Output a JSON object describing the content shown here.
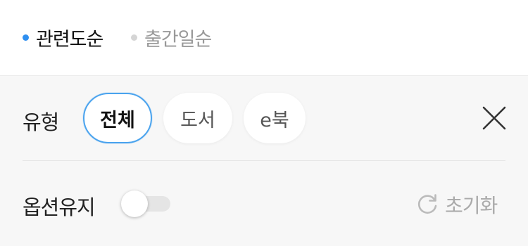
{
  "sort": {
    "options": [
      {
        "label": "관련도순",
        "active": true
      },
      {
        "label": "출간일순",
        "active": false
      }
    ]
  },
  "filter": {
    "type_label": "유형",
    "chips": [
      {
        "label": "전체",
        "selected": true
      },
      {
        "label": "도서",
        "selected": false
      },
      {
        "label": "e북",
        "selected": false
      }
    ],
    "close_icon": "close-icon",
    "keep_option_label": "옵션유지",
    "keep_option_on": false,
    "reset_label": "초기화",
    "reset_icon": "refresh-icon"
  },
  "colors": {
    "accent": "#2f8ff0",
    "chip_selected_border": "#4aa3ee",
    "panel_bg": "#f7f7f7"
  }
}
